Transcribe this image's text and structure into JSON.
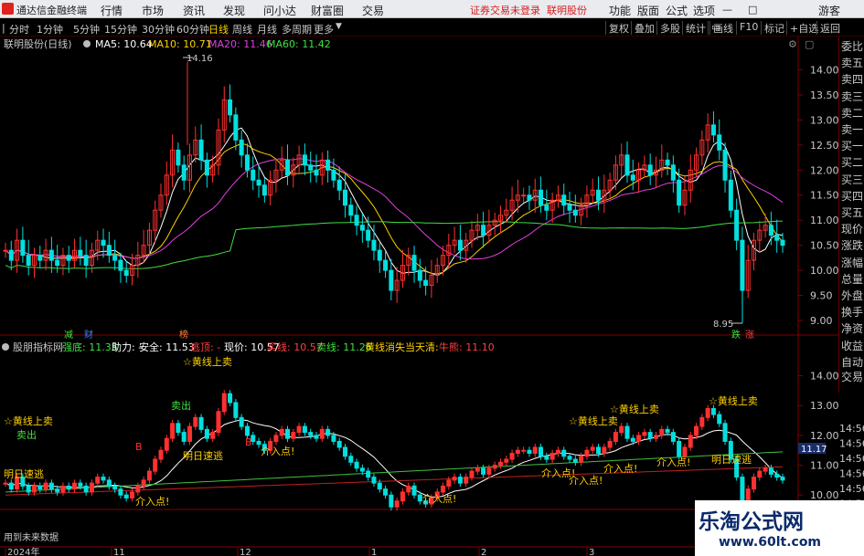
{
  "menubar": {
    "brand": "通达信金融终端",
    "menus": [
      "行情",
      "市场",
      "资讯",
      "发现",
      "问小达",
      "财富圈",
      "交易"
    ],
    "status": "证券交易未登录",
    "stock_name": "联明股份",
    "right_menus": [
      "功能",
      "版面",
      "公式",
      "选项"
    ],
    "guest": "游客"
  },
  "toolbar": {
    "periods": [
      "分时",
      "1分钟",
      "5分钟",
      "15分钟",
      "30分钟",
      "60分钟",
      "日线",
      "周线",
      "月线",
      "多周期",
      "更多"
    ],
    "active_period": "日线",
    "right_buttons": [
      "复权",
      "叠加",
      "多股",
      "统计",
      "画线",
      "F10",
      "标记",
      "+自选",
      "返回"
    ]
  },
  "main_chart": {
    "title": "联明股份(日线)",
    "ma_labels": [
      {
        "text": "MA5: 10.64",
        "color": "#ffffff"
      },
      {
        "text": "MA10: 10.71",
        "color": "#ffd000"
      },
      {
        "text": "MA20: 11.46",
        "color": "#e040e0"
      },
      {
        "text": "MA60: 11.42",
        "color": "#40e040"
      }
    ],
    "high_label": "14.16",
    "low_label": "8.95",
    "y_ticks": [
      "14.00",
      "13.50",
      "13.00",
      "12.50",
      "12.00",
      "11.50",
      "11.00",
      "10.50",
      "10.00",
      "9.50",
      "9.00"
    ],
    "markers": [
      {
        "text": "减",
        "color": "#40e040"
      },
      {
        "text": "财",
        "color": "#4080ff"
      },
      {
        "text": "榜",
        "color": "#ff8040"
      },
      {
        "text": "跌",
        "color": "#40e040"
      },
      {
        "text": "涨",
        "color": "#ff4040"
      }
    ]
  },
  "indicator": {
    "name": "股朋指标网",
    "fields": [
      {
        "text": "强底: 11.35",
        "color": "#40e040"
      },
      {
        "text": "助力: -",
        "color": "#ffffff"
      },
      {
        "text": "安全: 11.53",
        "color": "#ffffff"
      },
      {
        "text": "逃顶: -",
        "color": "#ff4040"
      },
      {
        "text": "现价: 10.57",
        "color": "#ffffff"
      },
      {
        "text": "买线: 10.57",
        "color": "#ff4040"
      },
      {
        "text": "卖线: 11.26",
        "color": "#40e040"
      },
      {
        "text": "黄线消失当天清: -",
        "color": "#ffd000"
      },
      {
        "text": "牛熊: 11.10",
        "color": "#ff4040"
      }
    ],
    "y_ticks": [
      "14.00",
      "13.00",
      "12.00",
      "11.00",
      "10.00"
    ],
    "current_price_tag": "11.17",
    "annotations": [
      "☆黄线上卖",
      "卖出",
      "☆黄线上卖",
      "卖出",
      "☆黄线上卖",
      "☆黄线上卖",
      "☆黄线上卖",
      "明日速逃",
      "明日速逃",
      "明日速逃",
      "介入点!",
      "介入点!",
      "介入点!",
      "介入点!",
      "介入点!",
      "介入点!",
      "介入点!",
      "B",
      "B"
    ]
  },
  "right_panel": {
    "items": [
      "委比",
      "卖五",
      "卖四",
      "卖三",
      "卖二",
      "卖一",
      "买一",
      "买二",
      "买三",
      "买四",
      "买五",
      "现价",
      "涨跌",
      "涨幅",
      "总量",
      "外盘",
      "换手",
      "净资",
      "收益",
      "自动",
      "交易"
    ],
    "times": [
      "14:56",
      "14:56",
      "14:56",
      "14:56",
      "14:56",
      "14:56",
      "14:56",
      "14:56"
    ]
  },
  "bottom": {
    "hint": "用到未来数据",
    "x_labels": [
      "2024年",
      "11",
      "12",
      "1",
      "2",
      "3"
    ]
  },
  "watermark": {
    "line1": "乐淘公式网",
    "line2": "www.60lt.com"
  }
}
